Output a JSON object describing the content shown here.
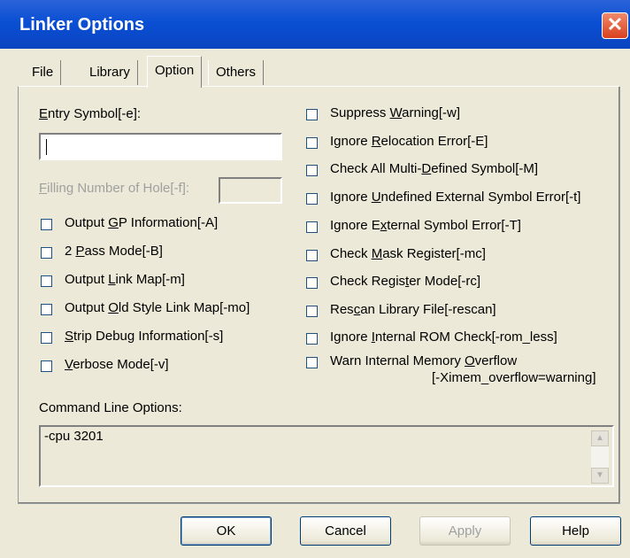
{
  "window": {
    "title": "Linker Options",
    "close_glyph": "✕"
  },
  "tabs": [
    {
      "label": "File",
      "active": false
    },
    {
      "label": "Library",
      "active": false
    },
    {
      "label": "Option",
      "active": true
    },
    {
      "label": "Others",
      "active": false
    }
  ],
  "entry_symbol": {
    "label_pre": "",
    "label_ul": "E",
    "label_post": "ntry Symbol[-e]:",
    "value": ""
  },
  "filling": {
    "label_pre": "",
    "label_ul": "F",
    "label_post": "illing Number of Hole[-f]:",
    "value": "",
    "enabled": false
  },
  "left_options": [
    {
      "pre": "Output ",
      "ul": "G",
      "post": "P Information[-A]",
      "checked": false
    },
    {
      "pre": "2 ",
      "ul": "P",
      "post": "ass Mode[-B]",
      "checked": false
    },
    {
      "pre": "Output ",
      "ul": "L",
      "post": "ink Map[-m]",
      "checked": false
    },
    {
      "pre": "Output ",
      "ul": "O",
      "post": "ld Style Link Map[-mo]",
      "checked": false
    },
    {
      "pre": "",
      "ul": "S",
      "post": "trip Debug Information[-s]",
      "checked": false
    },
    {
      "pre": "",
      "ul": "V",
      "post": "erbose Mode[-v]",
      "checked": false
    }
  ],
  "right_options": [
    {
      "pre": "Suppress ",
      "ul": "W",
      "post": "arning[-w]",
      "checked": false
    },
    {
      "pre": "Ignore ",
      "ul": "R",
      "post": "elocation Error[-E]",
      "checked": false
    },
    {
      "pre": "Check All Multi-",
      "ul": "D",
      "post": "efined Symbol[-M]",
      "checked": false
    },
    {
      "pre": "Ignore ",
      "ul": "U",
      "post": "ndefined External Symbol Error[-t]",
      "checked": false
    },
    {
      "pre": "Ignore E",
      "ul": "x",
      "post": "ternal Symbol Error[-T]",
      "checked": false
    },
    {
      "pre": "Check ",
      "ul": "M",
      "post": "ask Register[-mc]",
      "checked": false
    },
    {
      "pre": "Check Regis",
      "ul": "t",
      "post": "er Mode[-rc]",
      "checked": false
    },
    {
      "pre": "Res",
      "ul": "c",
      "post": "an Library File[-rescan]",
      "checked": false
    },
    {
      "pre": "Ignore ",
      "ul": "I",
      "post": "nternal ROM Check[-rom_less]",
      "checked": false
    },
    {
      "pre": "Warn Internal Memory ",
      "ul": "O",
      "post": "verflow",
      "checked": false,
      "line2": "[-Ximem_overflow=warning]"
    }
  ],
  "command_line": {
    "label": "Command Line Options:",
    "value": "-cpu 3201"
  },
  "buttons": {
    "ok": "OK",
    "cancel": "Cancel",
    "apply": "Apply",
    "help": "Help"
  }
}
